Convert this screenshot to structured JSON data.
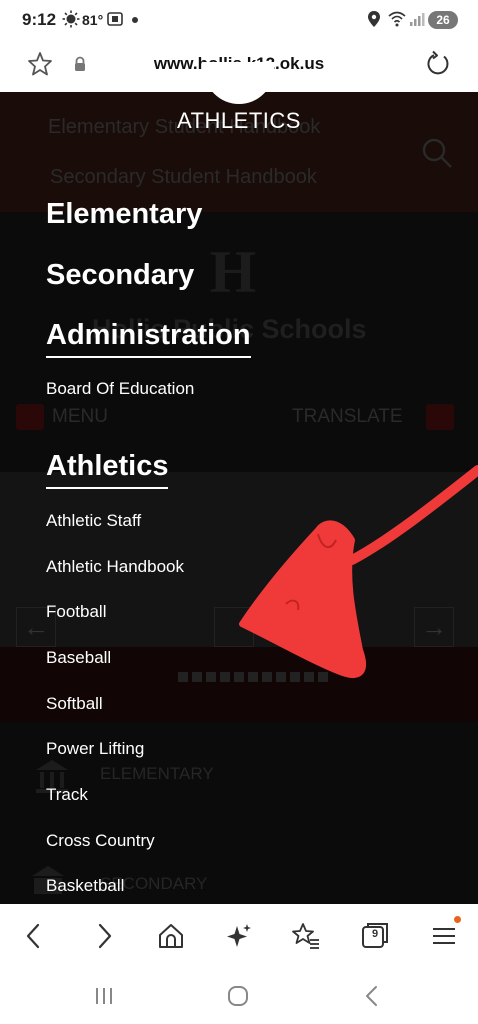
{
  "status_bar": {
    "time": "9:12",
    "temperature": "81°",
    "battery": "26"
  },
  "url_bar": {
    "url": "www.hollis.k12.ok.us"
  },
  "background_page": {
    "elementary_handbook": "Elementary Student Handbook",
    "secondary_handbook": "Secondary Student Handbook",
    "logo_letter": "H",
    "school_name": "Hollis Public Schools",
    "menu_label": "MENU",
    "translate_label": "TRANSLATE",
    "elementary_label": "ELEMENTARY",
    "secondary_label": "SECONDARY"
  },
  "nav": {
    "title": "ATHLETICS",
    "headings": {
      "elementary": "Elementary",
      "secondary": "Secondary",
      "administration": "Administration",
      "athletics": "Athletics"
    },
    "administration_links": [
      "Board Of Education"
    ],
    "athletics_links": [
      "Athletic Staff",
      "Athletic Handbook",
      "Football",
      "Baseball",
      "Softball",
      "Power Lifting",
      "Track",
      "Cross Country",
      "Basketball"
    ]
  },
  "toolbar": {
    "tab_count": "9",
    "notification_color": "#e8631c"
  },
  "colors": {
    "overlay_background": "#000000",
    "annotation_red": "#f03a3a"
  }
}
